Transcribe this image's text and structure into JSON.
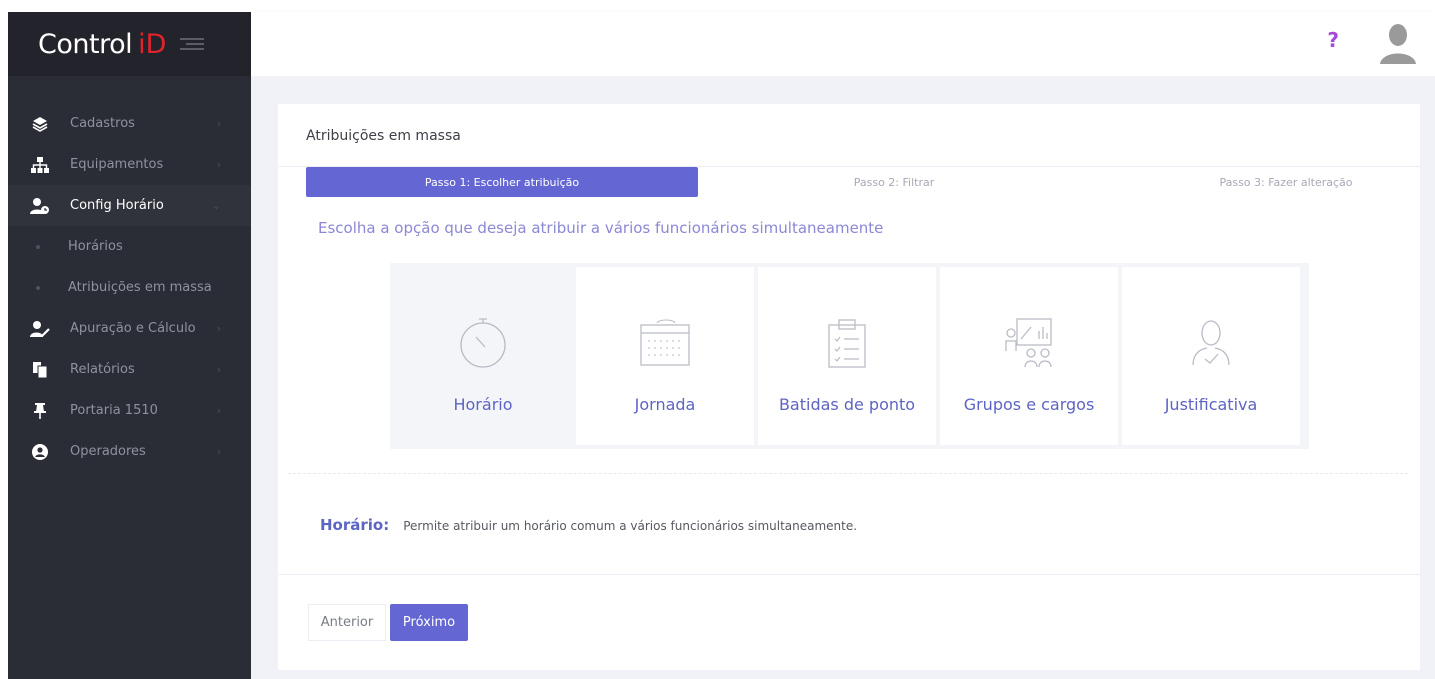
{
  "brand": {
    "name": "Control",
    "suffix": "iD"
  },
  "sidebar": {
    "items": [
      {
        "label": "Cadastros",
        "icon": "layers-icon"
      },
      {
        "label": "Equipamentos",
        "icon": "sitemap-icon"
      },
      {
        "label": "Config Horário",
        "icon": "user-clock-icon",
        "active": true,
        "children": [
          {
            "label": "Horários"
          },
          {
            "label": "Atribuições em massa"
          }
        ]
      },
      {
        "label": "Apuração e Cálculo",
        "icon": "user-edit-icon"
      },
      {
        "label": "Relatórios",
        "icon": "copy-icon"
      },
      {
        "label": "Portaria 1510",
        "icon": "pin-icon"
      },
      {
        "label": "Operadores",
        "icon": "user-circle-icon"
      }
    ]
  },
  "topbar": {
    "help_label": "?"
  },
  "card": {
    "title": "Atribuições em massa",
    "steps": [
      {
        "label": "Passo 1: Escolher atribuição",
        "active": true
      },
      {
        "label": "Passo 2: Filtrar",
        "active": false
      },
      {
        "label": "Passo 3: Fazer alteração",
        "active": false
      }
    ],
    "instruction": "Escolha a opção que deseja atribuir a vários funcionários simultaneamente",
    "options": [
      {
        "label": "Horário",
        "icon": "stopwatch-icon",
        "selected": true
      },
      {
        "label": "Jornada",
        "icon": "calendar-icon",
        "selected": false
      },
      {
        "label": "Batidas de ponto",
        "icon": "clipboard-checklist-icon",
        "selected": false
      },
      {
        "label": "Grupos e cargos",
        "icon": "group-chart-icon",
        "selected": false
      },
      {
        "label": "Justificativa",
        "icon": "user-check-icon",
        "selected": false
      }
    ],
    "description": {
      "key": "Horário:",
      "text": "Permite atribuir um horário comum a vários funcionários simultaneamente."
    },
    "buttons": {
      "previous": "Anterior",
      "next": "Próximo"
    }
  },
  "colors": {
    "accent": "#6466d3",
    "brand_red": "#e3232b",
    "help": "#a64ad8",
    "sidebar": "#2b2d36"
  }
}
